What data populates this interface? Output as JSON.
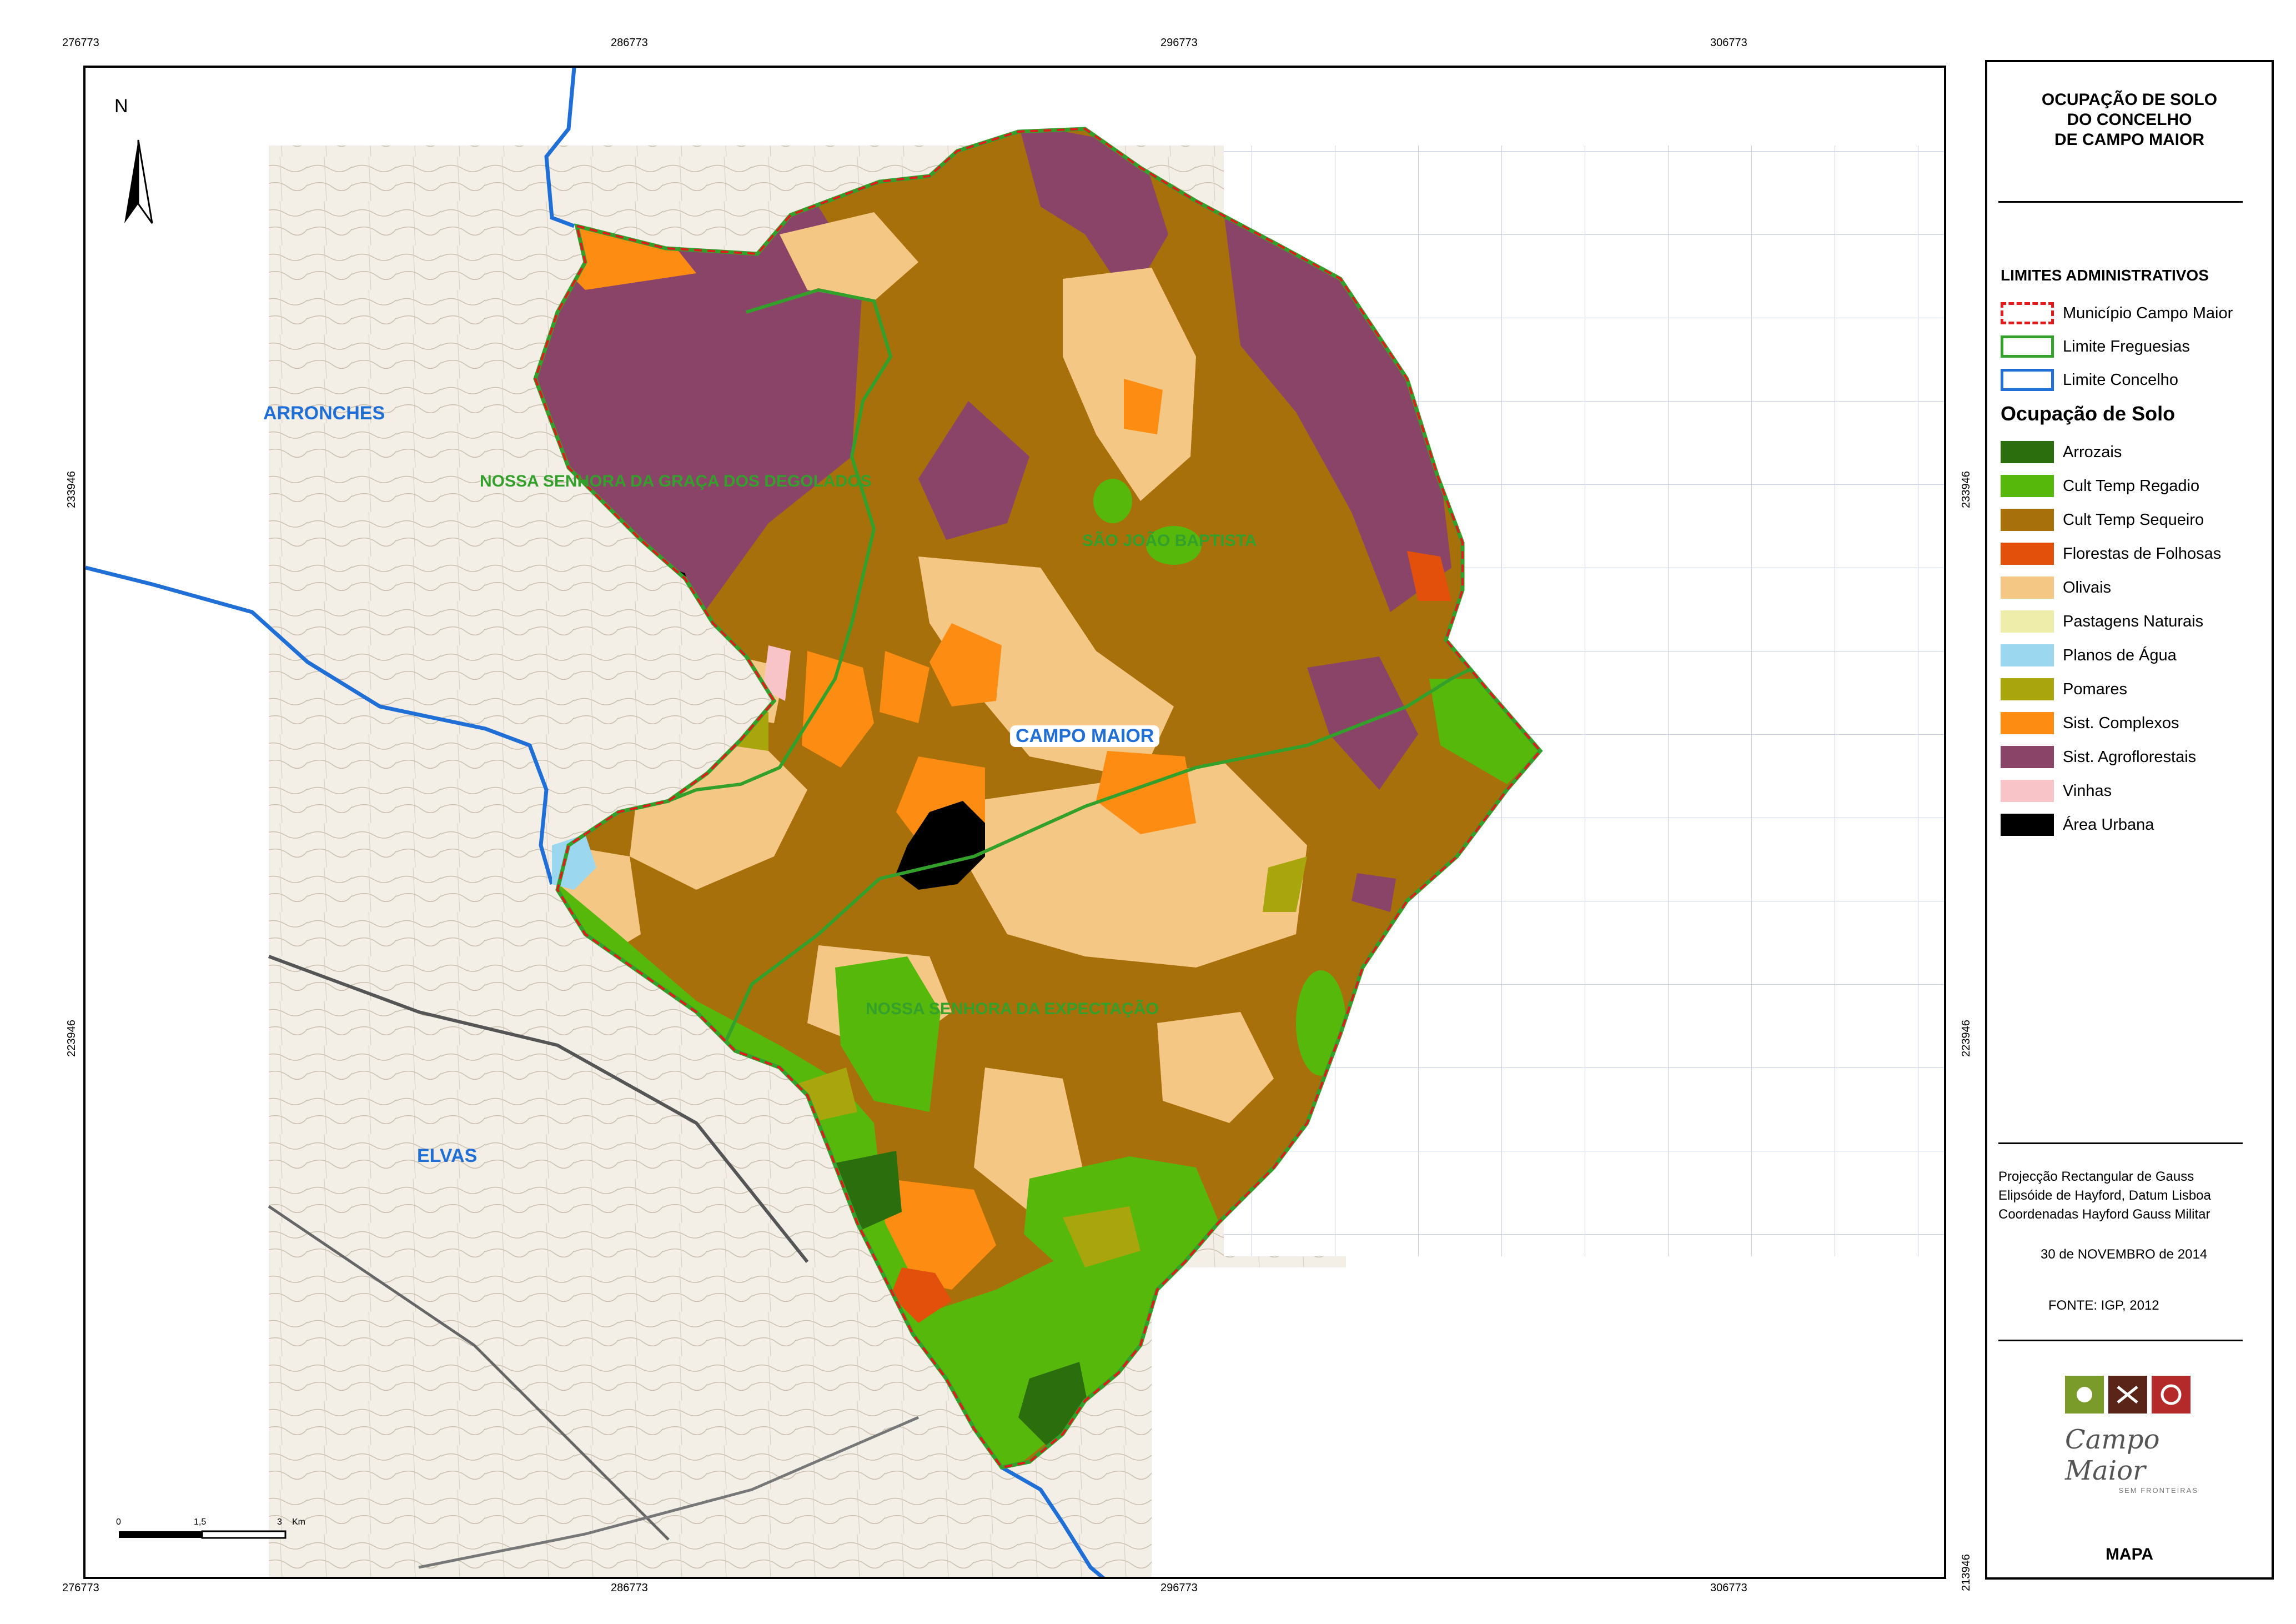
{
  "coords": {
    "top": [
      "276773",
      "286773",
      "296773",
      "306773"
    ],
    "bottom": [
      "276773",
      "286773",
      "296773",
      "306773"
    ],
    "left": [
      "233946",
      "223946"
    ],
    "right": [
      "233946",
      "223946",
      "213946"
    ]
  },
  "map": {
    "north_label": "N",
    "places": {
      "arronches": "ARRONCHES",
      "elvas": "ELVAS",
      "campo_maior": "CAMPO MAIOR",
      "freguesia_graca": "NOSSA SENHORA DA GRAÇA DOS DEGOLADOS",
      "freguesia_sao_joao": "SÃO JOÃO BAPTISTA",
      "freguesia_expectacao": "NOSSA SENHORA DA EXPECTAÇÃO"
    },
    "scale": {
      "zero": "0",
      "mid": "1,5",
      "end": "3",
      "unit": "Km"
    }
  },
  "legend": {
    "title_lines": [
      "OCUPAÇÃO DE SOLO",
      "DO CONCELHO",
      "DE CAMPO MAIOR"
    ],
    "admin_heading": "LIMITES ADMINISTRATIVOS",
    "admin_items": [
      {
        "label": "Município Campo Maior",
        "color": "#e31a1c",
        "style": "dashed"
      },
      {
        "label": "Limite Freguesias",
        "color": "#33a02c",
        "style": "solid"
      },
      {
        "label": "Limite Concelho",
        "color": "#1f6fd6",
        "style": "solid"
      }
    ],
    "land_heading": "Ocupação de Solo",
    "land_items": [
      {
        "label": "Arrozais",
        "color": "#2a6e0e"
      },
      {
        "label": "Cult Temp Regadio",
        "color": "#57b80c"
      },
      {
        "label": "Cult Temp Sequeiro",
        "color": "#a8700a"
      },
      {
        "label": "Florestas de Folhosas",
        "color": "#e2500c"
      },
      {
        "label": "Olivais",
        "color": "#f4c884"
      },
      {
        "label": "Pastagens Naturais",
        "color": "#eeeeaa"
      },
      {
        "label": "Planos de Água",
        "color": "#9bd8f0"
      },
      {
        "label": "Pomares",
        "color": "#a9a50c"
      },
      {
        "label": "Sist. Complexos",
        "color": "#fd8c12"
      },
      {
        "label": "Sist. Agroflorestais",
        "color": "#8a4468"
      },
      {
        "label": "Vinhas",
        "color": "#f8c4c8"
      },
      {
        "label": "Área Urbana",
        "color": "#000000"
      }
    ],
    "projection_lines": [
      "Projecção  Rectangular de Gauss",
      "Elipsóide de Hayford, Datum Lisboa",
      "Coordenadas Hayford Gauss Militar"
    ],
    "date": "30 de NOVEMBRO de 2014",
    "source": "FONTE: IGP, 2012",
    "logo_text": "Campo Maior",
    "logo_subtext": "SEM FRONTEIRAS",
    "footer": "MAPA"
  }
}
